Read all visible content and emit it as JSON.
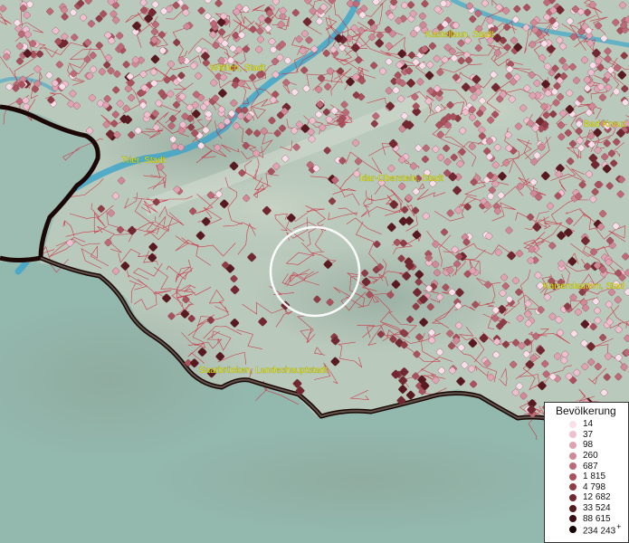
{
  "map": {
    "places": [
      {
        "name": "Kastellaun, Stadt"
      },
      {
        "name": "Wittlich, Stadt"
      },
      {
        "name": "Bad Kreuz"
      },
      {
        "name": "Trier, Stadt"
      },
      {
        "name": "Idar-Oberstein, Stadt"
      },
      {
        "name": "Kaiserslautern, Stad"
      },
      {
        "name": "Saarbrücken, Landeshauptstadt"
      }
    ],
    "colors": {
      "background_water": "#8fb9ad",
      "land": "#b7c7bb",
      "municipality_border": "#d0243a",
      "state_border": "#1a0706",
      "river": "#3fa6c9",
      "label": "#e8e60a",
      "highlight_circle": "#ffffff"
    }
  },
  "legend": {
    "title": "Bevölkerung",
    "classes": [
      {
        "label": "14",
        "color": "#f8dfe9"
      },
      {
        "label": "37",
        "color": "#eebfcf"
      },
      {
        "label": "98",
        "color": "#e0a3b3"
      },
      {
        "label": "260",
        "color": "#d08a97"
      },
      {
        "label": "687",
        "color": "#bd6a78"
      },
      {
        "label": "1 815",
        "color": "#a8525e"
      },
      {
        "label": "4 798",
        "color": "#8e3c45"
      },
      {
        "label": "12 682",
        "color": "#722831"
      },
      {
        "label": "33 524",
        "color": "#571a20"
      },
      {
        "label": "88 615",
        "color": "#3a0e12"
      },
      {
        "label": "234 243",
        "color": "#160406"
      }
    ],
    "overflow_marker": "+"
  }
}
